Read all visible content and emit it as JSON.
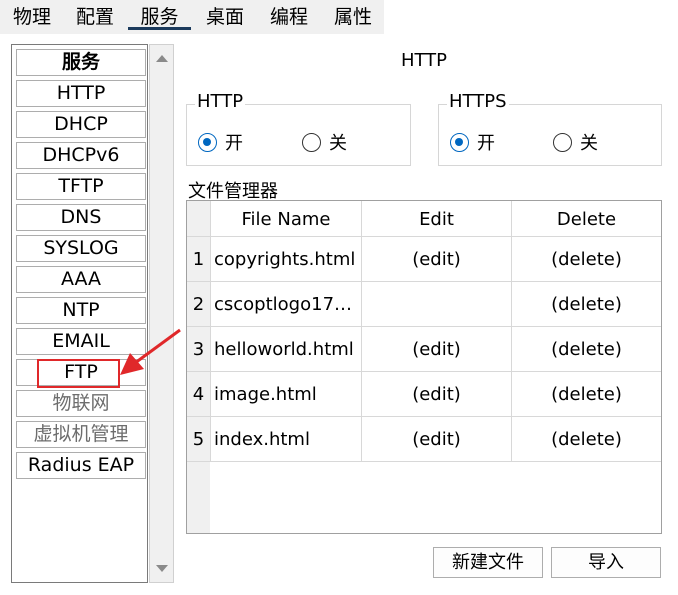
{
  "tabs": [
    "物理",
    "配置",
    "服务",
    "桌面",
    "编程",
    "属性"
  ],
  "active_tab_index": 2,
  "services": {
    "header": "服务",
    "items": [
      "HTTP",
      "DHCP",
      "DHCPv6",
      "TFTP",
      "DNS",
      "SYSLOG",
      "AAA",
      "NTP",
      "EMAIL",
      "FTP",
      "物联网",
      "虚拟机管理",
      "Radius EAP"
    ],
    "disabled": [
      "物联网",
      "虚拟机管理"
    ],
    "highlighted": "FTP"
  },
  "page": {
    "title": "HTTP"
  },
  "http_group": {
    "label": "HTTP",
    "on_label": "开",
    "off_label": "关",
    "selected": "开"
  },
  "https_group": {
    "label": "HTTPS",
    "on_label": "开",
    "off_label": "关",
    "selected": "开"
  },
  "file_manager": {
    "label": "文件管理器",
    "columns": [
      "File Name",
      "Edit",
      "Delete"
    ],
    "rows": [
      {
        "num": "1",
        "name": "copyrights.html",
        "edit": "(edit)",
        "delete": "(delete)"
      },
      {
        "num": "2",
        "name": "cscoptlogo17…",
        "edit": "",
        "delete": "(delete)"
      },
      {
        "num": "3",
        "name": "helloworld.html",
        "edit": "(edit)",
        "delete": "(delete)"
      },
      {
        "num": "4",
        "name": "image.html",
        "edit": "(edit)",
        "delete": "(delete)"
      },
      {
        "num": "5",
        "name": "index.html",
        "edit": "(edit)",
        "delete": "(delete)"
      }
    ]
  },
  "buttons": {
    "new_file": "新建文件",
    "import": "导入"
  },
  "colors": {
    "accent": "#0067c0",
    "highlight": "#e0282a",
    "tab_underline": "#1b3a5c"
  },
  "icons": [
    "scroll-up-icon",
    "scroll-down-icon",
    "red-arrow-icon"
  ]
}
